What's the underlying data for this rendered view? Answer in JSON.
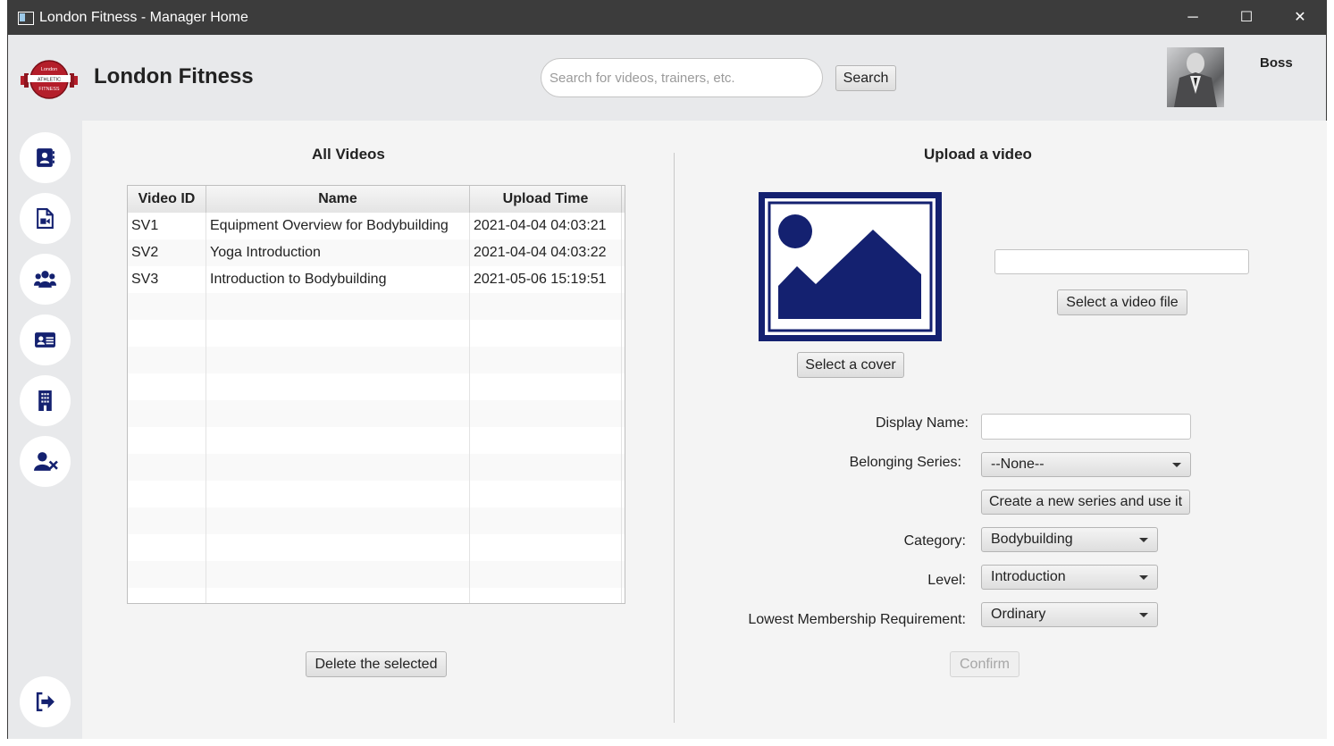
{
  "window": {
    "title": "London Fitness - Manager Home",
    "minimize": "─",
    "maximize": "☐",
    "close": "✕"
  },
  "header": {
    "brand": "London Fitness",
    "logo_text_top": "London",
    "logo_text_mid": "ATHLETIC",
    "logo_text_bottom": "FITNESS",
    "search_placeholder": "Search for videos, trainers, etc.",
    "search_button": "Search",
    "username": "Boss"
  },
  "sidebar": {
    "items": [
      {
        "icon": "contacts-book-icon"
      },
      {
        "icon": "video-file-icon"
      },
      {
        "icon": "users-group-icon"
      },
      {
        "icon": "id-card-icon"
      },
      {
        "icon": "building-icon"
      },
      {
        "icon": "user-remove-icon"
      }
    ],
    "logout_icon": "sign-out-icon"
  },
  "videos": {
    "title": "All Videos",
    "columns": [
      "Video ID",
      "Name",
      "Upload Time"
    ],
    "rows": [
      {
        "id": "SV1",
        "name": "Equipment Overview for Bodybuilding",
        "time": "2021-04-04 04:03:21"
      },
      {
        "id": "SV2",
        "name": "Yoga Introduction",
        "time": "2021-04-04 04:03:22"
      },
      {
        "id": "SV3",
        "name": "Introduction to Bodybuilding",
        "time": "2021-05-06 15:19:51"
      }
    ],
    "delete_button": "Delete the selected"
  },
  "upload": {
    "title": "Upload a video",
    "select_cover_button": "Select a cover",
    "select_video_button": "Select a video file",
    "video_file_value": "",
    "display_name_label": "Display Name:",
    "display_name_value": "",
    "series_label": "Belonging Series:",
    "series_value": "--None--",
    "new_series_button": "Create a new series and use it",
    "category_label": "Category:",
    "category_value": "Bodybuilding",
    "level_label": "Level:",
    "level_value": "Introduction",
    "membership_label": "Lowest Membership Requirement:",
    "membership_value": "Ordinary",
    "confirm_button": "Confirm"
  },
  "colors": {
    "titlebar": "#3c3c3c",
    "accent_navy": "#142170",
    "logo_red": "#b41e2a"
  }
}
